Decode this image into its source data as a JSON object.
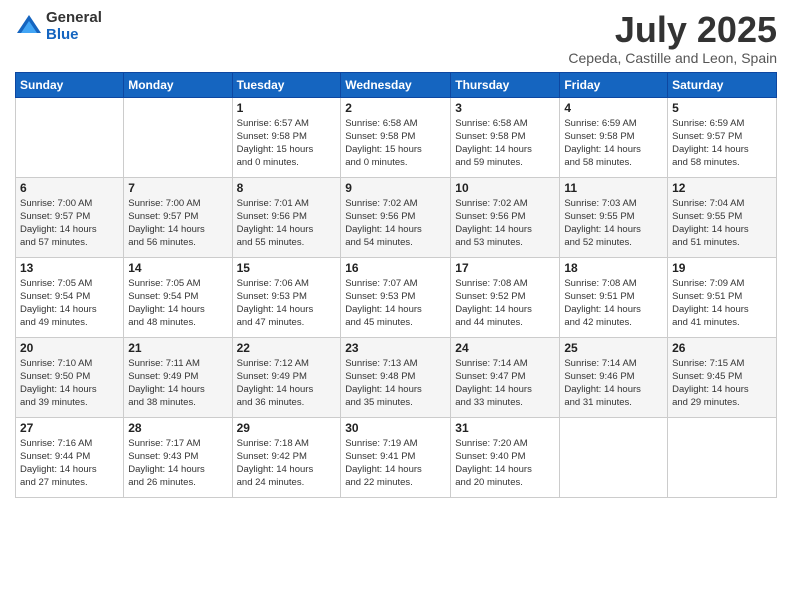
{
  "header": {
    "logo_general": "General",
    "logo_blue": "Blue",
    "month_title": "July 2025",
    "location": "Cepeda, Castille and Leon, Spain"
  },
  "columns": [
    "Sunday",
    "Monday",
    "Tuesday",
    "Wednesday",
    "Thursday",
    "Friday",
    "Saturday"
  ],
  "weeks": [
    [
      {
        "day": "",
        "info": ""
      },
      {
        "day": "",
        "info": ""
      },
      {
        "day": "1",
        "info": "Sunrise: 6:57 AM\nSunset: 9:58 PM\nDaylight: 15 hours\nand 0 minutes."
      },
      {
        "day": "2",
        "info": "Sunrise: 6:58 AM\nSunset: 9:58 PM\nDaylight: 15 hours\nand 0 minutes."
      },
      {
        "day": "3",
        "info": "Sunrise: 6:58 AM\nSunset: 9:58 PM\nDaylight: 14 hours\nand 59 minutes."
      },
      {
        "day": "4",
        "info": "Sunrise: 6:59 AM\nSunset: 9:58 PM\nDaylight: 14 hours\nand 58 minutes."
      },
      {
        "day": "5",
        "info": "Sunrise: 6:59 AM\nSunset: 9:57 PM\nDaylight: 14 hours\nand 58 minutes."
      }
    ],
    [
      {
        "day": "6",
        "info": "Sunrise: 7:00 AM\nSunset: 9:57 PM\nDaylight: 14 hours\nand 57 minutes."
      },
      {
        "day": "7",
        "info": "Sunrise: 7:00 AM\nSunset: 9:57 PM\nDaylight: 14 hours\nand 56 minutes."
      },
      {
        "day": "8",
        "info": "Sunrise: 7:01 AM\nSunset: 9:56 PM\nDaylight: 14 hours\nand 55 minutes."
      },
      {
        "day": "9",
        "info": "Sunrise: 7:02 AM\nSunset: 9:56 PM\nDaylight: 14 hours\nand 54 minutes."
      },
      {
        "day": "10",
        "info": "Sunrise: 7:02 AM\nSunset: 9:56 PM\nDaylight: 14 hours\nand 53 minutes."
      },
      {
        "day": "11",
        "info": "Sunrise: 7:03 AM\nSunset: 9:55 PM\nDaylight: 14 hours\nand 52 minutes."
      },
      {
        "day": "12",
        "info": "Sunrise: 7:04 AM\nSunset: 9:55 PM\nDaylight: 14 hours\nand 51 minutes."
      }
    ],
    [
      {
        "day": "13",
        "info": "Sunrise: 7:05 AM\nSunset: 9:54 PM\nDaylight: 14 hours\nand 49 minutes."
      },
      {
        "day": "14",
        "info": "Sunrise: 7:05 AM\nSunset: 9:54 PM\nDaylight: 14 hours\nand 48 minutes."
      },
      {
        "day": "15",
        "info": "Sunrise: 7:06 AM\nSunset: 9:53 PM\nDaylight: 14 hours\nand 47 minutes."
      },
      {
        "day": "16",
        "info": "Sunrise: 7:07 AM\nSunset: 9:53 PM\nDaylight: 14 hours\nand 45 minutes."
      },
      {
        "day": "17",
        "info": "Sunrise: 7:08 AM\nSunset: 9:52 PM\nDaylight: 14 hours\nand 44 minutes."
      },
      {
        "day": "18",
        "info": "Sunrise: 7:08 AM\nSunset: 9:51 PM\nDaylight: 14 hours\nand 42 minutes."
      },
      {
        "day": "19",
        "info": "Sunrise: 7:09 AM\nSunset: 9:51 PM\nDaylight: 14 hours\nand 41 minutes."
      }
    ],
    [
      {
        "day": "20",
        "info": "Sunrise: 7:10 AM\nSunset: 9:50 PM\nDaylight: 14 hours\nand 39 minutes."
      },
      {
        "day": "21",
        "info": "Sunrise: 7:11 AM\nSunset: 9:49 PM\nDaylight: 14 hours\nand 38 minutes."
      },
      {
        "day": "22",
        "info": "Sunrise: 7:12 AM\nSunset: 9:49 PM\nDaylight: 14 hours\nand 36 minutes."
      },
      {
        "day": "23",
        "info": "Sunrise: 7:13 AM\nSunset: 9:48 PM\nDaylight: 14 hours\nand 35 minutes."
      },
      {
        "day": "24",
        "info": "Sunrise: 7:14 AM\nSunset: 9:47 PM\nDaylight: 14 hours\nand 33 minutes."
      },
      {
        "day": "25",
        "info": "Sunrise: 7:14 AM\nSunset: 9:46 PM\nDaylight: 14 hours\nand 31 minutes."
      },
      {
        "day": "26",
        "info": "Sunrise: 7:15 AM\nSunset: 9:45 PM\nDaylight: 14 hours\nand 29 minutes."
      }
    ],
    [
      {
        "day": "27",
        "info": "Sunrise: 7:16 AM\nSunset: 9:44 PM\nDaylight: 14 hours\nand 27 minutes."
      },
      {
        "day": "28",
        "info": "Sunrise: 7:17 AM\nSunset: 9:43 PM\nDaylight: 14 hours\nand 26 minutes."
      },
      {
        "day": "29",
        "info": "Sunrise: 7:18 AM\nSunset: 9:42 PM\nDaylight: 14 hours\nand 24 minutes."
      },
      {
        "day": "30",
        "info": "Sunrise: 7:19 AM\nSunset: 9:41 PM\nDaylight: 14 hours\nand 22 minutes."
      },
      {
        "day": "31",
        "info": "Sunrise: 7:20 AM\nSunset: 9:40 PM\nDaylight: 14 hours\nand 20 minutes."
      },
      {
        "day": "",
        "info": ""
      },
      {
        "day": "",
        "info": ""
      }
    ]
  ]
}
